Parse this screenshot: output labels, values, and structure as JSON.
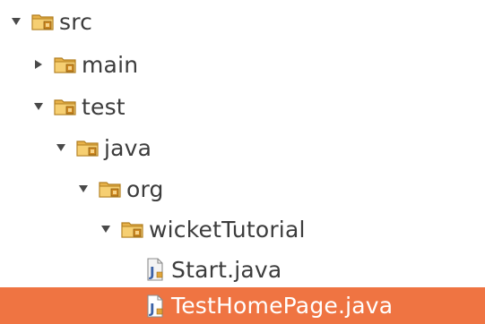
{
  "tree": {
    "rows": [
      {
        "label": "src",
        "indent": 0,
        "expander": "expanded",
        "icon": "package-folder-icon",
        "selected": false
      },
      {
        "label": "main",
        "indent": 1,
        "expander": "collapsed",
        "icon": "package-folder-icon",
        "selected": false
      },
      {
        "label": "test",
        "indent": 1,
        "expander": "expanded",
        "icon": "package-folder-icon",
        "selected": false
      },
      {
        "label": "java",
        "indent": 2,
        "expander": "expanded",
        "icon": "package-folder-icon",
        "selected": false
      },
      {
        "label": "org",
        "indent": 3,
        "expander": "expanded",
        "icon": "package-folder-icon",
        "selected": false
      },
      {
        "label": "wicketTutorial",
        "indent": 4,
        "expander": "expanded",
        "icon": "package-folder-icon",
        "selected": false
      },
      {
        "label": "Start.java",
        "indent": 5,
        "expander": "none",
        "icon": "java-file-icon",
        "selected": false
      },
      {
        "label": "TestHomePage.java",
        "indent": 5,
        "expander": "none",
        "icon": "java-file-icon",
        "selected": true
      }
    ]
  },
  "colors": {
    "selection": "#ef7442",
    "text": "#3c3c3c",
    "selected_text": "#ffffff",
    "folder": "#e8b24a",
    "folder_dark": "#b07d1f",
    "file_bg": "#f4f4f4",
    "file_accent": "#3c62a6"
  }
}
